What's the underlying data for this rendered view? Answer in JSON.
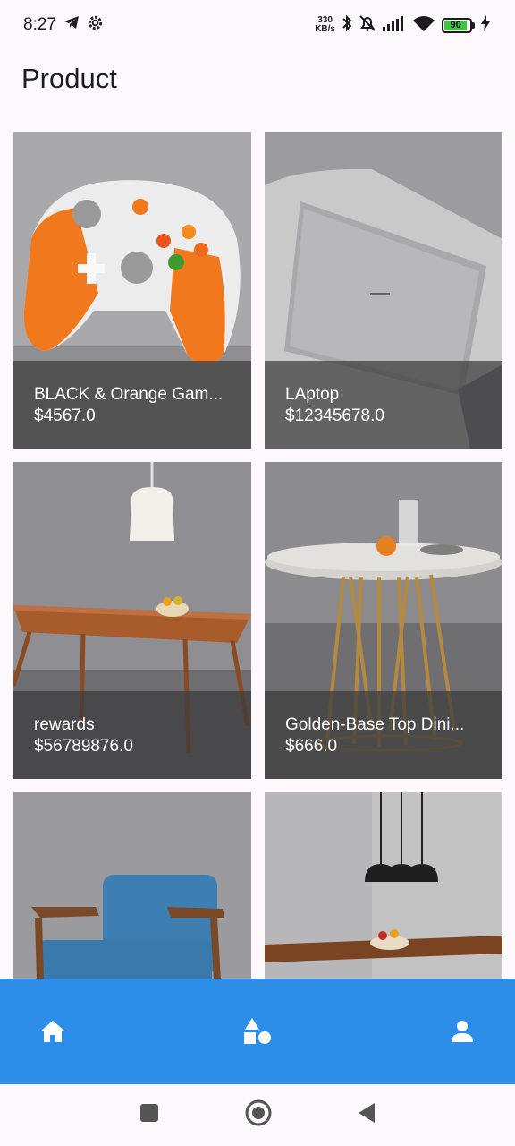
{
  "status_bar": {
    "time": "8:27",
    "net_speed_value": "330",
    "net_speed_unit": "KB/s",
    "battery_level": "90"
  },
  "page": {
    "title": "Product"
  },
  "products": [
    {
      "name": "BLACK & Orange Gam...",
      "price": "$4567.0",
      "image_icon": "game-controller-image"
    },
    {
      "name": "LAptop",
      "price": "$12345678.0",
      "image_icon": "laptop-image"
    },
    {
      "name": "rewards",
      "price": "$56789876.0",
      "image_icon": "dining-table-image"
    },
    {
      "name": "Golden-Base Top Dini...",
      "price": "$666.0",
      "image_icon": "round-table-image"
    },
    {
      "name": "",
      "price": "",
      "image_icon": "blue-armchair-image"
    },
    {
      "name": "",
      "price": "",
      "image_icon": "table-with-lamps-image"
    }
  ],
  "bottom_nav": {
    "items": [
      "home-icon",
      "categories-icon",
      "profile-icon"
    ],
    "color": "#2c8ee8"
  }
}
